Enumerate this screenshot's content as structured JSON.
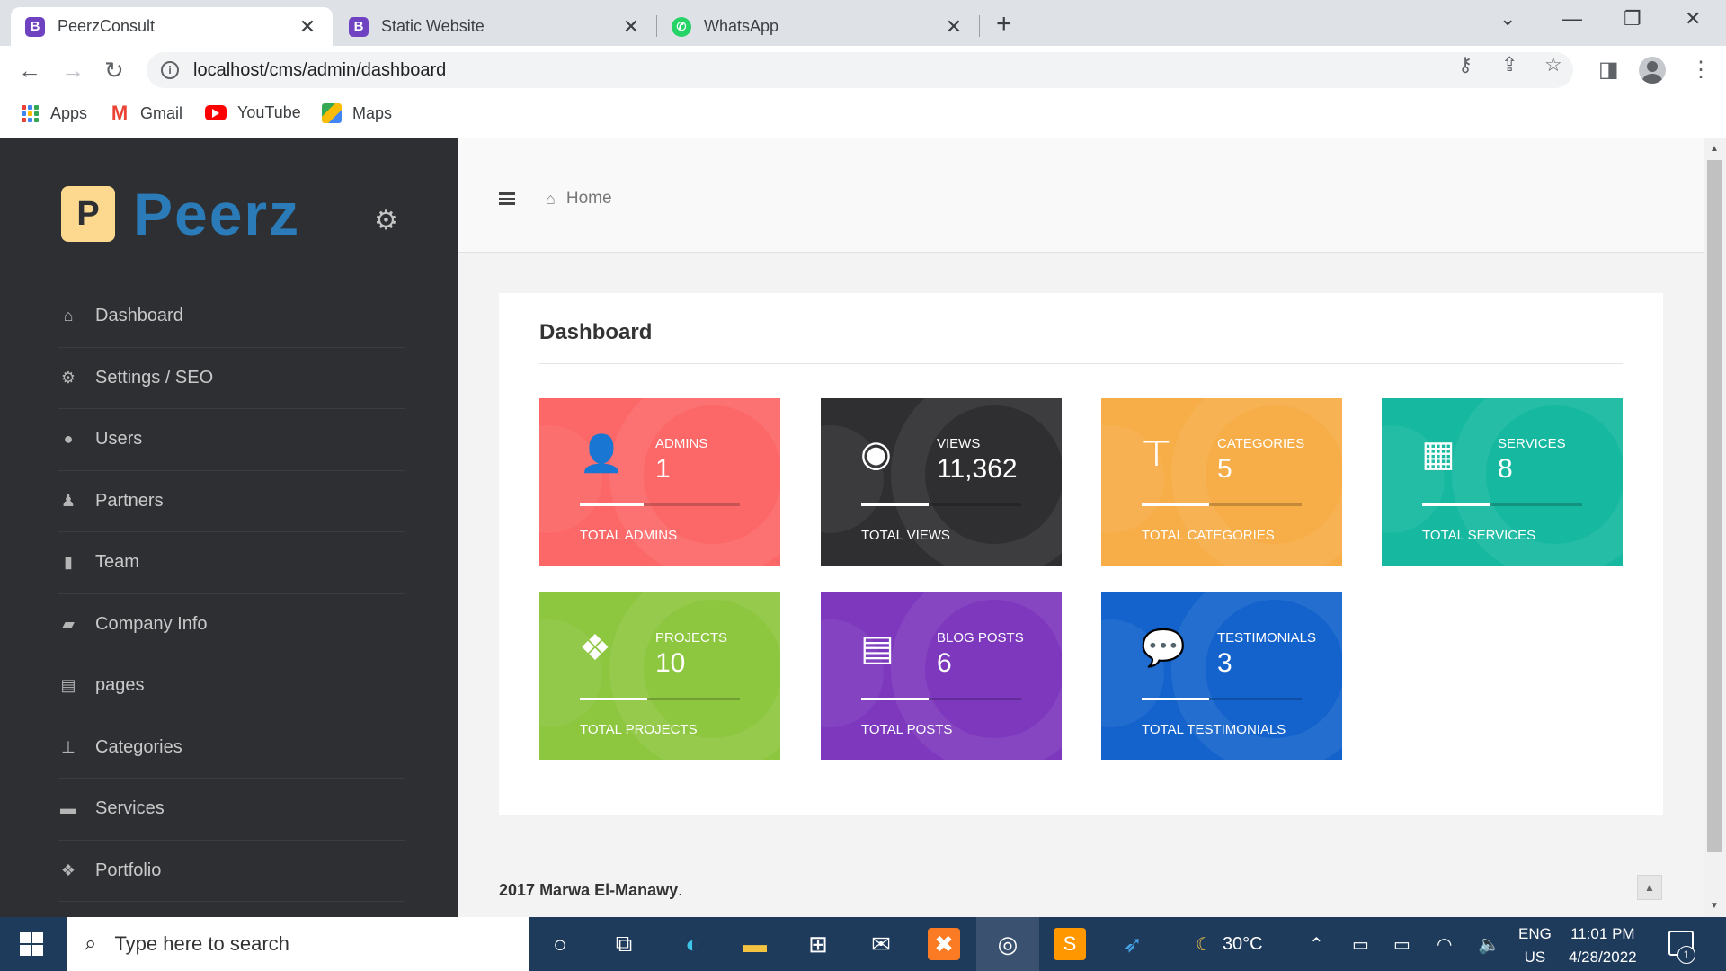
{
  "browser": {
    "tabs": [
      {
        "title": "PeerzConsult",
        "favicon": "B",
        "active": true
      },
      {
        "title": "Static Website",
        "favicon": "B",
        "active": false
      },
      {
        "title": "WhatsApp",
        "favicon": "whatsapp-icon",
        "active": false
      }
    ],
    "url": "localhost/cms/admin/dashboard",
    "bookmarks": [
      {
        "label": "Apps",
        "icon": "apps-grid-icon"
      },
      {
        "label": "Gmail",
        "icon": "gmail-icon"
      },
      {
        "label": "YouTube",
        "icon": "youtube-icon"
      },
      {
        "label": "Maps",
        "icon": "maps-icon"
      }
    ]
  },
  "sidebar": {
    "logo_letter": "P",
    "logo_text": "Peerz",
    "items": [
      {
        "label": "Dashboard",
        "icon": "home-icon"
      },
      {
        "label": "Settings / SEO",
        "icon": "cogs-icon"
      },
      {
        "label": "Users",
        "icon": "users-icon"
      },
      {
        "label": "Partners",
        "icon": "partners-icon"
      },
      {
        "label": "Team",
        "icon": "team-icon"
      },
      {
        "label": "Company Info",
        "icon": "book-icon"
      },
      {
        "label": "pages",
        "icon": "file-icon"
      },
      {
        "label": "Categories",
        "icon": "sitemap-icon"
      },
      {
        "label": "Services",
        "icon": "briefcase-icon"
      },
      {
        "label": "Portfolio",
        "icon": "cubes-icon"
      }
    ]
  },
  "header": {
    "breadcrumb": "Home"
  },
  "dashboard": {
    "title": "Dashboard",
    "cards": [
      {
        "label": "ADMINS",
        "value": "1",
        "footer": "TOTAL ADMINS",
        "icon": "user-icon",
        "color": "#fc6767",
        "progress": 0.4
      },
      {
        "label": "VIEWS",
        "value": "11,362",
        "footer": "TOTAL VIEWS",
        "icon": "eye-icon",
        "color": "#2f2f31",
        "progress": 0.42
      },
      {
        "label": "CATEGORIES",
        "value": "5",
        "footer": "TOTAL CATEGORIES",
        "icon": "sitemap-icon",
        "color": "#f7ad48",
        "progress": 0.42
      },
      {
        "label": "SERVICES",
        "value": "8",
        "footer": "TOTAL SERVICES",
        "icon": "briefcase-icon",
        "color": "#16b8a0",
        "progress": 0.42
      },
      {
        "label": "PROJECTS",
        "value": "10",
        "footer": "TOTAL PROJECTS",
        "icon": "cubes-icon",
        "color": "#8dc63f",
        "progress": 0.42
      },
      {
        "label": "BLOG POSTS",
        "value": "6",
        "footer": "TOTAL POSTS",
        "icon": "newspaper-icon",
        "color": "#7d38be",
        "progress": 0.42
      },
      {
        "label": "TESTIMONIALS",
        "value": "3",
        "footer": "TOTAL TESTIMONIALS",
        "icon": "comments-icon",
        "color": "#1463cc",
        "progress": 0.42
      }
    ]
  },
  "footer": {
    "year": "2017",
    "author": "Marwa El-Manawy",
    "suffix": "."
  },
  "taskbar": {
    "search_placeholder": "Type here to search",
    "weather": "30°C",
    "lang_top": "ENG",
    "lang_bottom": "US",
    "time": "11:01 PM",
    "date": "4/28/2022",
    "notification_count": "1"
  }
}
